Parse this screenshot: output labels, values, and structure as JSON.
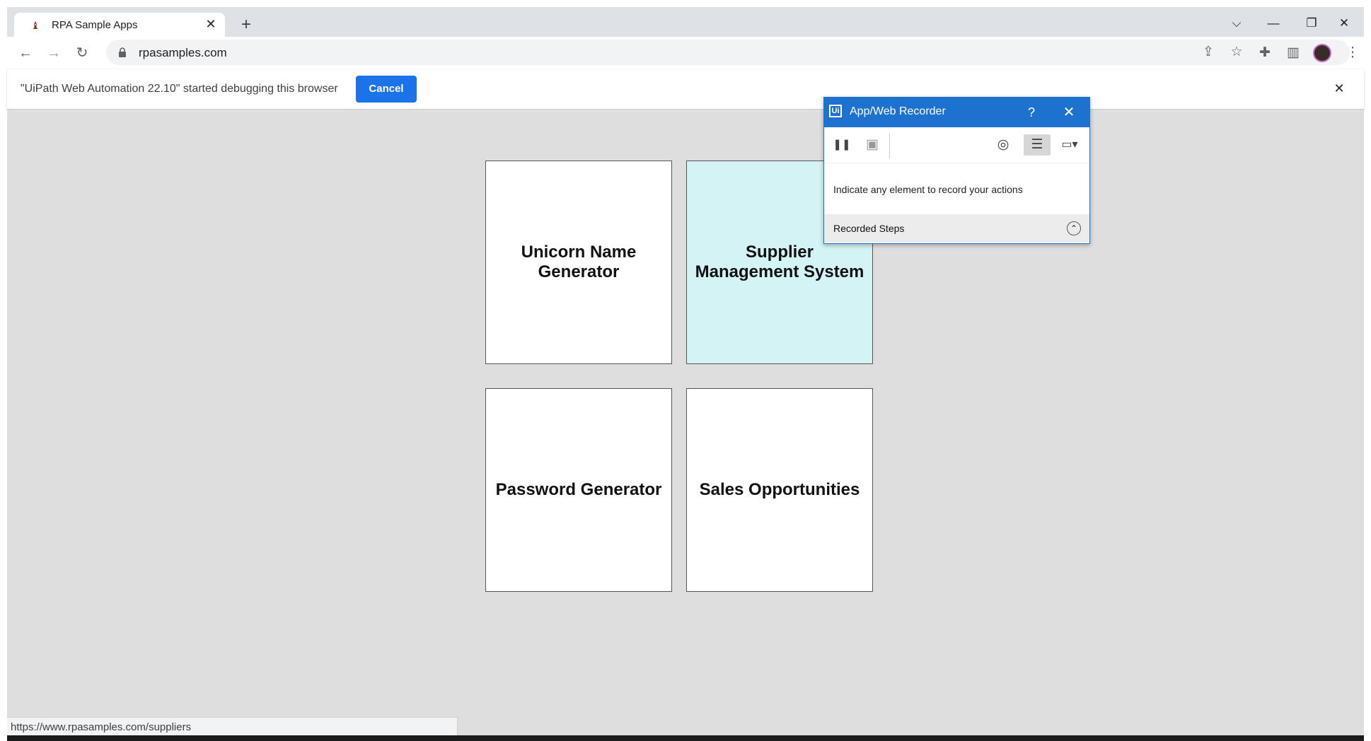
{
  "browser": {
    "tab": {
      "title": "RPA Sample Apps",
      "close": "✕"
    },
    "new_tab": "+",
    "window_controls": {
      "tab_search": "⌵",
      "minimize": "—",
      "restore": "❐",
      "close": "✕"
    },
    "toolbar": {
      "back": "←",
      "forward": "→",
      "reload": "↻",
      "url": "rpasamples.com",
      "share_icon": "⇪",
      "bookmark_icon": "☆",
      "extensions_icon": "✚",
      "side_panel_icon": "▥",
      "menu_icon": "⋮"
    },
    "infobar": {
      "message": "\"UiPath Web Automation 22.10\" started debugging this browser",
      "cancel_label": "Cancel",
      "close": "✕"
    },
    "status_url": "https://www.rpasamples.com/suppliers"
  },
  "tiles": [
    {
      "label": "Unicorn Name Generator",
      "highlighted": false
    },
    {
      "label": "Supplier Management System",
      "highlighted": true
    },
    {
      "label": "Password Generator",
      "highlighted": false
    },
    {
      "label": "Sales Opportunities",
      "highlighted": false
    }
  ],
  "recorder": {
    "logo": "Ui",
    "title": "App/Web Recorder",
    "help": "?",
    "close": "✕",
    "tools": {
      "pause": "❚❚",
      "save": "▣",
      "target": "◎",
      "steps": "☰",
      "screen": "▭▾"
    },
    "hint": "Indicate any element to record your actions",
    "steps_label": "Recorded Steps",
    "collapse": "⌃"
  },
  "colors": {
    "accent": "#1a73e8",
    "recorder_blue": "#1d72d0",
    "tile_highlight": "#d3f3f5",
    "page_bg": "#dedede"
  }
}
